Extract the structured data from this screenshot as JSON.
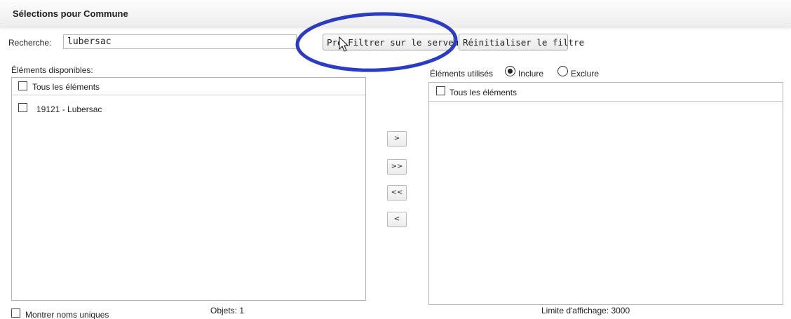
{
  "header": {
    "title": "Sélections pour Commune"
  },
  "search": {
    "label": "Recherche:",
    "value": "lubersac",
    "filter_button": "Pré-Filtrer sur le serveur",
    "reset_button": "Réinitialiser le filtre"
  },
  "available": {
    "label": "Éléments disponibles:",
    "all_label": "Tous les éléments",
    "items": [
      {
        "label": "19121 - Lubersac",
        "checked": false
      }
    ]
  },
  "used": {
    "label": "Éléments utilisés",
    "include_label": "Inclure",
    "exclude_label": "Exclure",
    "mode": "include",
    "all_label": "Tous les éléments"
  },
  "transfer": {
    "move_right": ">",
    "move_all_right": ">>",
    "move_all_left": "<<",
    "move_left": "<"
  },
  "footer": {
    "unique_names_label": "Montrer noms uniques",
    "objects_count": "Objets: 1",
    "display_limit": "Limite d'affichage: 3000"
  },
  "colors": {
    "annotation_ellipse": "#2b3bc4",
    "header_bg": "#f2f2f2"
  },
  "icons": {
    "cursor": "hand-pointer-icon"
  }
}
